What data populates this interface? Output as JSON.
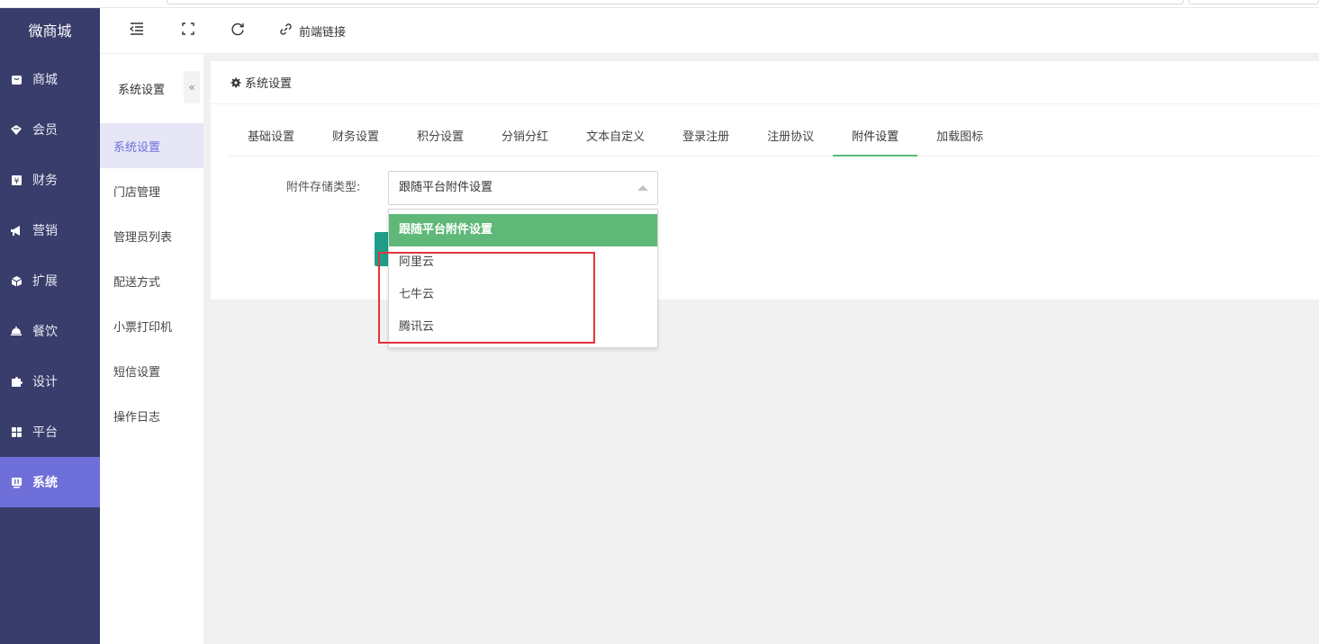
{
  "app": {
    "logo": "微商城"
  },
  "sidebar": {
    "items": [
      {
        "label": "商城",
        "icon": "shop-icon"
      },
      {
        "label": "会员",
        "icon": "member-icon"
      },
      {
        "label": "财务",
        "icon": "finance-icon"
      },
      {
        "label": "营销",
        "icon": "megaphone-icon"
      },
      {
        "label": "扩展",
        "icon": "cube-icon"
      },
      {
        "label": "餐饮",
        "icon": "dish-icon"
      },
      {
        "label": "设计",
        "icon": "puzzle-icon"
      },
      {
        "label": "平台",
        "icon": "grid-icon"
      },
      {
        "label": "系统",
        "icon": "system-icon",
        "active": true
      }
    ]
  },
  "header": {
    "link_label": "前端链接"
  },
  "submenu": {
    "title": "系统设置",
    "collapse_glyph": "«",
    "items": [
      "系统设置",
      "门店管理",
      "管理员列表",
      "配送方式",
      "小票打印机",
      "短信设置",
      "操作日志"
    ]
  },
  "card": {
    "title": "系统设置",
    "tabs": [
      "基础设置",
      "财务设置",
      "积分设置",
      "分销分红",
      "文本自定义",
      "登录注册",
      "注册协议",
      "附件设置",
      "加载图标"
    ],
    "active_tab": "附件设置"
  },
  "form": {
    "storage_label": "附件存储类型:",
    "storage_value": "跟随平台附件设置",
    "options": [
      "跟随平台附件设置",
      "阿里云",
      "七牛云",
      "腾讯云"
    ]
  },
  "colors": {
    "sidebar_bg": "#393d6b",
    "sidebar_active": "#6e6fd9",
    "selected_option": "#5fb878",
    "tab_underline": "#5cb87a",
    "annotation": "#e5343c"
  }
}
